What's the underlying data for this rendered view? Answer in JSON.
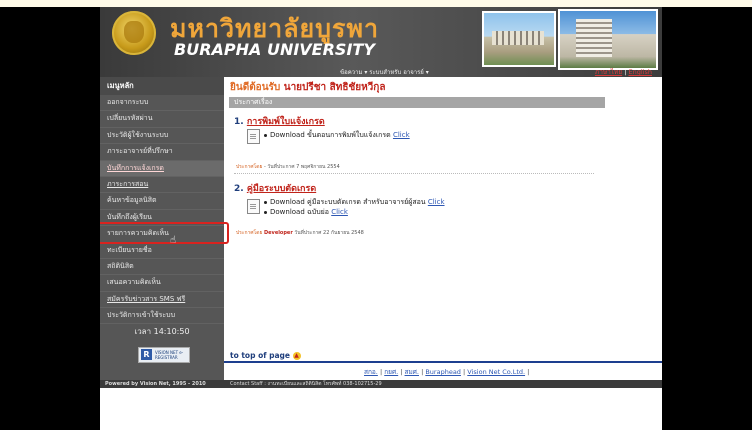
{
  "header": {
    "title_th": "มหาวิทยาลัยบูรพา",
    "title_en": "BURAPHA UNIVERSITY",
    "top_menu": "ข้อความ ▾ ระบบสำหรับ อาจารย์ ▾",
    "lang_th": "ภาษาไทย",
    "lang_sep": "|",
    "lang_en": "English"
  },
  "sidebar": {
    "title": "เมนูหลัก",
    "items": [
      {
        "label": "ออกจากระบบ"
      },
      {
        "label": "เปลี่ยนรหัสผ่าน"
      },
      {
        "label": "ประวัติผู้ใช้งานระบบ"
      },
      {
        "label": "ภาระอาจารย์ที่ปรึกษา"
      },
      {
        "label": "บันทึกการแจ้งเกรด"
      },
      {
        "label": "ภาระการสอน"
      },
      {
        "label": "ค้นหาข้อมูลนิสิต"
      },
      {
        "label": "บันทึกถึงผู้เรียน"
      },
      {
        "label": "รายการความคิดเห็น"
      },
      {
        "label": "ทะเบียนรายชื่อ"
      },
      {
        "label": "สถิตินิสิต"
      },
      {
        "label": "เสนอความคิดเห็น"
      },
      {
        "label": "สมัครรับข่าวสาร SMS ฟรี"
      },
      {
        "label": "ประวัติการเข้าใช้ระบบ"
      }
    ],
    "time": "เวลา 14:10:50",
    "sms_logo_letter": "R",
    "sms_logo_text": "VISION NET e-REGISTRAR"
  },
  "main": {
    "welcome_prefix": "ยินดีต้อนรับ",
    "welcome_name": "นายปรีชา สิทธิชัยหวีกุล",
    "announcement_header": "ประกาศเรื่อง",
    "sections": [
      {
        "number": "1.",
        "title": "การพิมพ์ใบแจ้งเกรด",
        "downloads": [
          {
            "text": "Download ขั้นตอนการพิมพ์ใบแจ้งเกรด",
            "link": "Click"
          }
        ],
        "meta_label": "ประกาศโดย",
        "meta_author": "-",
        "meta_date": "วันที่ประกาศ 7 พฤศจิกายน 2554"
      },
      {
        "number": "2.",
        "title": "คู่มือระบบตัดเกรด",
        "downloads": [
          {
            "text": "Download คู่มือระบบตัดเกรด สำหรับอาจารย์ผู้สอน",
            "link": "Click"
          },
          {
            "text": "Download ฉบับย่อ",
            "link": "Click"
          }
        ],
        "meta_label": "ประกาศโดย",
        "meta_author": "Developer",
        "meta_date": "วันที่ประกาศ 22 กันยายน 2548"
      }
    ],
    "to_top": "to top of page",
    "footer_links": {
      "l1": "สกอ.",
      "l2": "กยศ.",
      "l3": "สมศ.",
      "l4": "Buraphead",
      "l5": "Vision Net Co.Ltd.",
      "sep": "|"
    }
  },
  "bottom_bar": {
    "powered": "Powered by Vision Net, 1995 - 2010",
    "contact": "Contact Staff : งานทะเบียนและสถิตินิสิต โทรศัพท์ 038-102715-29"
  },
  "colors": {
    "header_bg": "#4a4a4a",
    "title_th": "#f0a63a",
    "accent_red": "#c0231a",
    "link_blue": "#2d57b3",
    "highlight_box": "#d9231f"
  }
}
